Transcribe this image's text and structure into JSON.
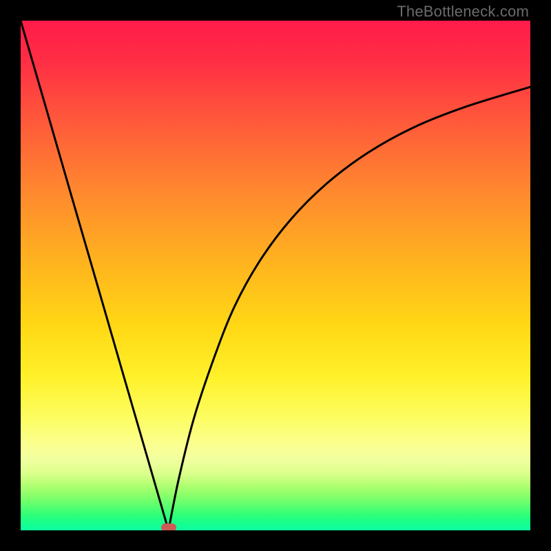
{
  "watermark": "TheBottleneck.com",
  "colors": {
    "frame_bg": "#000000",
    "curve": "#000000",
    "marker": "#cc5a55"
  },
  "chart_data": {
    "type": "line",
    "title": "",
    "xlabel": "",
    "ylabel": "",
    "xlim": [
      0,
      100
    ],
    "ylim": [
      0,
      100
    ],
    "series": [
      {
        "name": "left-branch",
        "x": [
          0,
          5,
          10,
          15,
          20,
          25,
          29
        ],
        "y": [
          100,
          82.8,
          65.5,
          48.3,
          31.0,
          13.8,
          0
        ]
      },
      {
        "name": "right-branch",
        "x": [
          29,
          31,
          34,
          38,
          42,
          47,
          53,
          60,
          68,
          77,
          87,
          100
        ],
        "y": [
          0,
          10,
          22,
          34,
          44,
          53,
          61,
          68,
          74,
          79,
          83,
          87
        ]
      }
    ],
    "marker": {
      "x": 29,
      "y": 0
    },
    "annotations": []
  }
}
